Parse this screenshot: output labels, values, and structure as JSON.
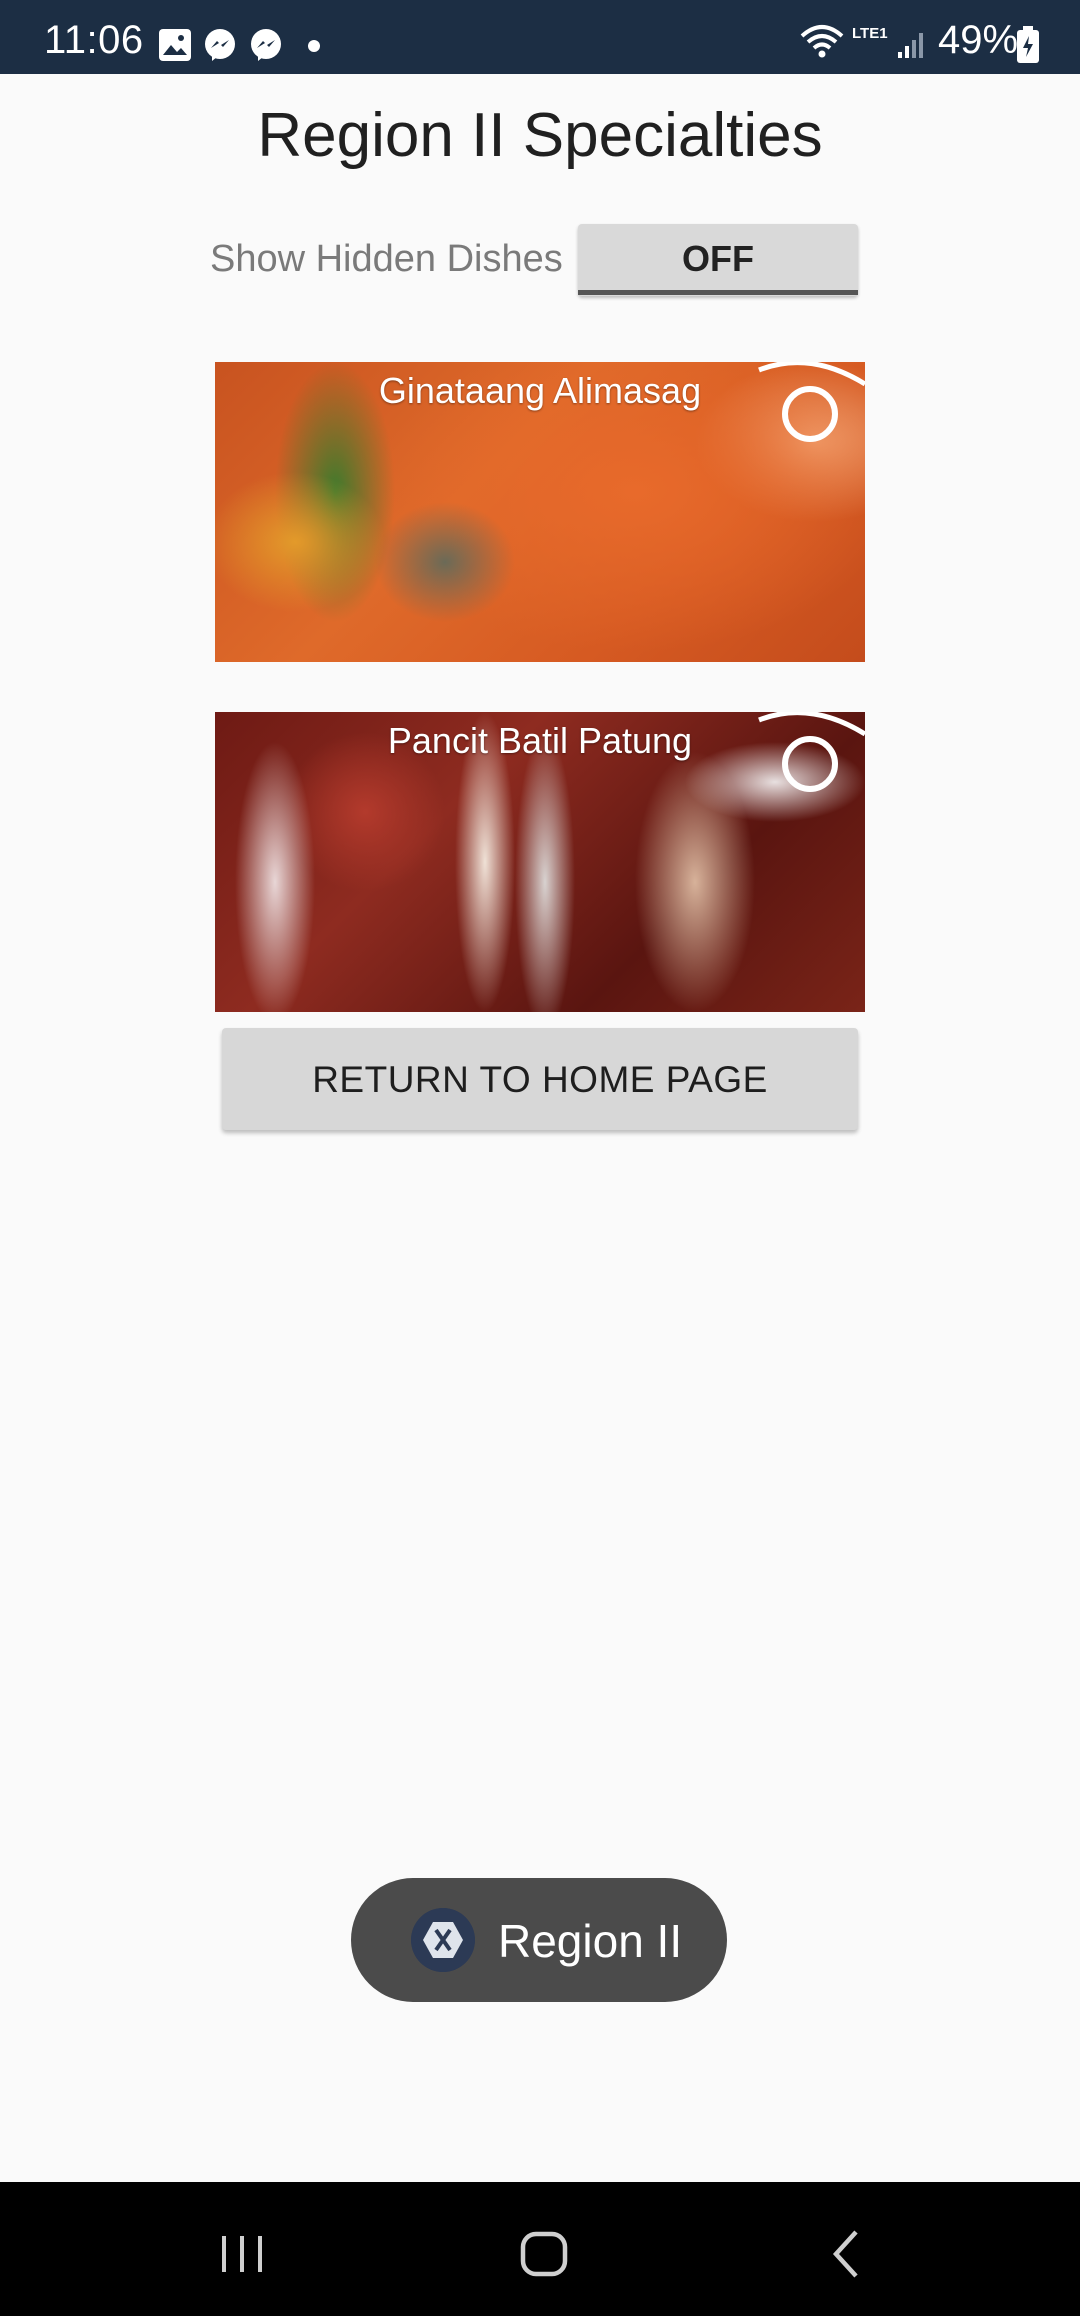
{
  "status_bar": {
    "time": "11:06",
    "battery": "49%",
    "network_label": "LTE1"
  },
  "page": {
    "title": "Region II Specialties"
  },
  "toggle": {
    "label": "Show Hidden Dishes",
    "state": "OFF"
  },
  "dishes": [
    {
      "name": "Ginataang Alimasag"
    },
    {
      "name": "Pancit Batil Patung"
    }
  ],
  "return_button": {
    "label": "RETURN TO HOME PAGE"
  },
  "toast": {
    "text": "Region II"
  },
  "colors": {
    "status_bar_bg": "#1c2e44",
    "page_bg": "#fafafa",
    "button_bg": "#d9d9d9",
    "toast_bg": "#4b4b4b",
    "nav_bar_bg": "#000000"
  },
  "icons": [
    "gallery-icon",
    "messenger-icon",
    "wifi-icon",
    "signal-icon",
    "battery-icon",
    "eye-icon",
    "xamarin-icon",
    "recent-apps-icon",
    "home-icon",
    "back-icon"
  ]
}
